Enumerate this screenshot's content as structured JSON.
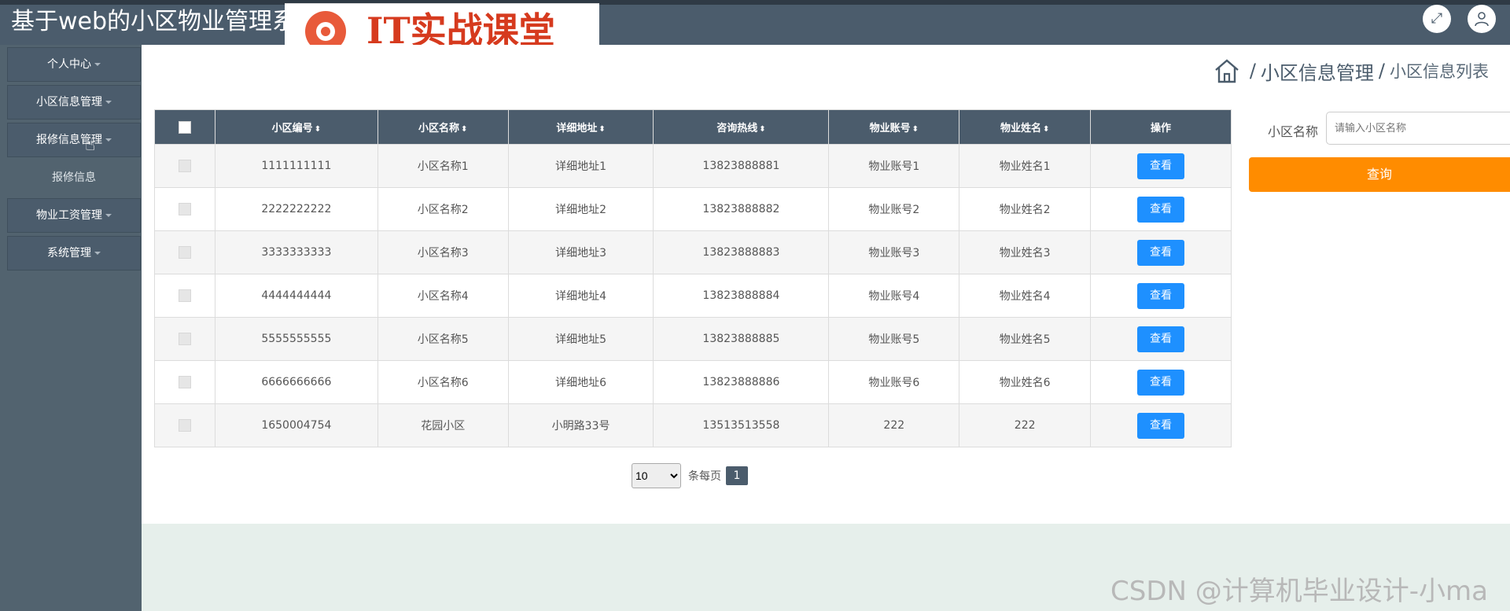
{
  "header": {
    "app_title": "基于web的小区物业管理系",
    "logo_text": "IT实战课堂",
    "expand_icon": "expand-icon",
    "user_icon": "user-icon"
  },
  "sidebar": {
    "items": [
      {
        "label": "个人中心",
        "has_caret": true
      },
      {
        "label": "小区信息管理",
        "has_caret": true
      },
      {
        "label": "报修信息管理",
        "has_caret": true
      },
      {
        "label": "报修信息",
        "has_caret": false
      },
      {
        "label": "物业工资管理",
        "has_caret": true
      },
      {
        "label": "系统管理",
        "has_caret": true
      }
    ]
  },
  "breadcrumb": {
    "home_icon": "home-icon",
    "section": "小区信息管理",
    "separator": "/",
    "page": "小区信息列表"
  },
  "table": {
    "headers": [
      "小区编号",
      "小区名称",
      "详细地址",
      "咨询热线",
      "物业账号",
      "物业姓名",
      "操作"
    ],
    "sort_glyph": "⬍",
    "view_label": "查看",
    "rows": [
      [
        "1111111111",
        "小区名称1",
        "详细地址1",
        "13823888881",
        "物业账号1",
        "物业姓名1"
      ],
      [
        "2222222222",
        "小区名称2",
        "详细地址2",
        "13823888882",
        "物业账号2",
        "物业姓名2"
      ],
      [
        "3333333333",
        "小区名称3",
        "详细地址3",
        "13823888883",
        "物业账号3",
        "物业姓名3"
      ],
      [
        "4444444444",
        "小区名称4",
        "详细地址4",
        "13823888884",
        "物业账号4",
        "物业姓名4"
      ],
      [
        "5555555555",
        "小区名称5",
        "详细地址5",
        "13823888885",
        "物业账号5",
        "物业姓名5"
      ],
      [
        "6666666666",
        "小区名称6",
        "详细地址6",
        "13823888886",
        "物业账号6",
        "物业姓名6"
      ],
      [
        "1650004754",
        "花园小区",
        "小明路33号",
        "13513513558",
        "222",
        "222"
      ]
    ]
  },
  "pagination": {
    "page_size": "10",
    "page_size_options": [
      "10"
    ],
    "per_page_label": "条每页",
    "current_page": "1"
  },
  "filter": {
    "label": "小区名称",
    "placeholder": "请输入小区名称",
    "query_label": "查询"
  },
  "watermark": "CSDN @计算机毕业设计-小ma",
  "colors": {
    "topbar": "#4b5c6c",
    "sidebar": "#52636f",
    "view_button": "#1e90ff",
    "query_button": "#ff8c00"
  }
}
